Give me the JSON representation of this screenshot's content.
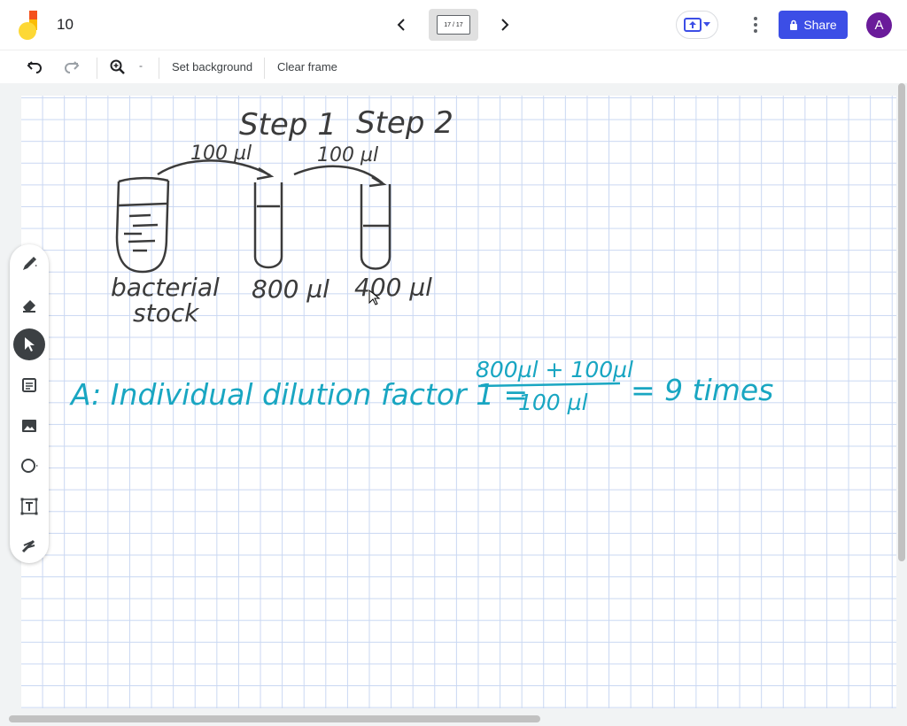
{
  "header": {
    "doc_title": "10",
    "frame_counter": "17 / 17",
    "share_label": "Share",
    "avatar_letter": "A"
  },
  "toolbar": {
    "zoom_caret": "-",
    "set_background": "Set background",
    "clear_frame": "Clear frame"
  },
  "colors": {
    "share_button": "#3c4ee6",
    "avatar": "#6a1b9a",
    "ink_dark": "#3b3b3b",
    "ink_cyan": "#19a6c2",
    "grid": "#c9d7f2"
  },
  "tools": [
    "pen-icon",
    "eraser-icon",
    "select-pointer-icon",
    "sticky-note-icon",
    "image-icon",
    "circle-shape-icon",
    "text-box-icon",
    "laser-icon"
  ],
  "whiteboard": {
    "heading_step1": "Step 1",
    "heading_step2": "Step 2",
    "transfer_1": "100 µl",
    "transfer_2": "100 µl",
    "label_stock_line1": "bacterial",
    "label_stock_line2": "stock",
    "label_tube1": "800 µl",
    "label_tube2": "400 µl",
    "equation_prefix": "A: Individual dilution factor 1 =",
    "equation_numerator": "800µl + 100µl",
    "equation_denominator": "100 µl",
    "equation_result": "= 9 times"
  }
}
